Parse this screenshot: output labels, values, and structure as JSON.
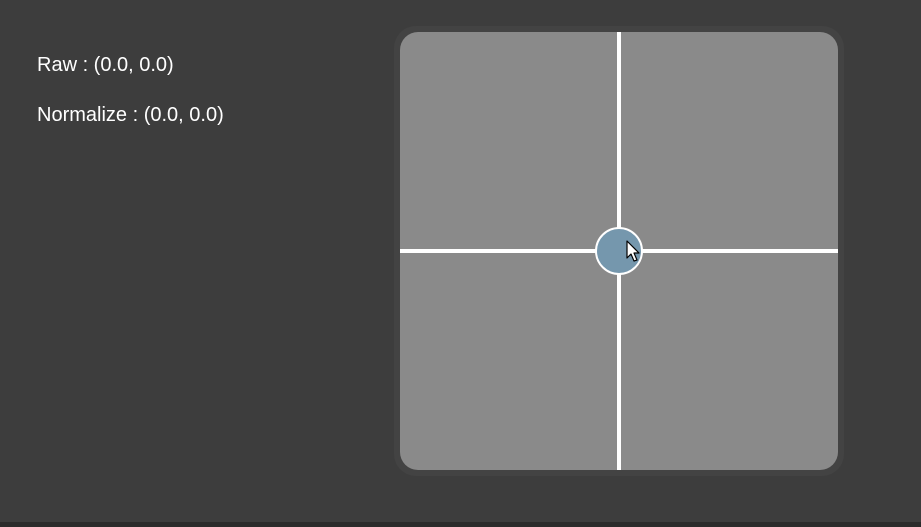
{
  "readouts": {
    "raw_text": "Raw : (0.0, 0.0)",
    "normalized_text": "Normalize : (0.0, 0.0)"
  },
  "joystick": {
    "raw": [
      0.0,
      0.0
    ],
    "normalized": [
      0.0,
      0.0
    ],
    "colors": {
      "background": "#3d3d3d",
      "pad": "#8a8a8a",
      "pad_border": "#434343",
      "axes": "#ffffff",
      "knob": "#7597ad",
      "knob_border": "#ffffff"
    }
  },
  "icons": {
    "cursor": "mouse-pointer-icon"
  }
}
